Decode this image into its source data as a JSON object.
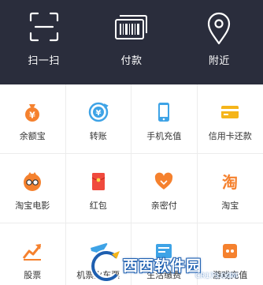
{
  "topbar": {
    "items": [
      {
        "label": "扫一扫",
        "icon": "scan-icon"
      },
      {
        "label": "付款",
        "icon": "barcode-pay-icon"
      },
      {
        "label": "附近",
        "icon": "location-pin-icon"
      }
    ]
  },
  "grid": {
    "items": [
      {
        "label": "余额宝",
        "icon": "money-bag-icon",
        "color": "#f5812e"
      },
      {
        "label": "转账",
        "icon": "transfer-icon",
        "color": "#3ea3e6"
      },
      {
        "label": "手机充值",
        "icon": "mobile-phone-icon",
        "color": "#3ea3e6"
      },
      {
        "label": "信用卡还款",
        "icon": "credit-card-icon",
        "color": "#f5b51a"
      },
      {
        "label": "淘宝电影",
        "icon": "movie-mascot-icon",
        "color": "#f5812e"
      },
      {
        "label": "红包",
        "icon": "red-envelope-icon",
        "color": "#f04a3d"
      },
      {
        "label": "亲密付",
        "icon": "heart-icon",
        "color": "#f5812e"
      },
      {
        "label": "淘宝",
        "icon": "taobao-icon",
        "color": "#f5812e"
      },
      {
        "label": "股票",
        "icon": "stock-chart-icon",
        "color": "#f5812e"
      },
      {
        "label": "机票火车票",
        "icon": "airplane-icon",
        "color": "#3ea3e6"
      },
      {
        "label": "生活缴费",
        "icon": "bill-icon",
        "color": "#3ea3e6"
      },
      {
        "label": "游戏充值",
        "icon": "game-icon",
        "color": "#f5812e"
      }
    ]
  },
  "watermark": {
    "text": "西西软件园",
    "domain": "CR173.COM"
  }
}
